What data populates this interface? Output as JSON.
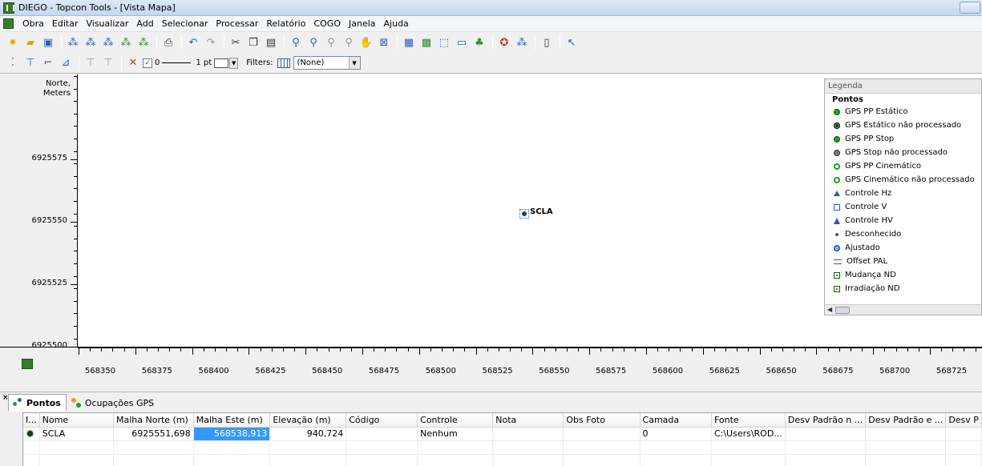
{
  "window": {
    "title": "DIEGO - Topcon Tools - [Vista Mapa]"
  },
  "menu": [
    "Obra",
    "Editar",
    "Visualizar",
    "Add",
    "Selecionar",
    "Processar",
    "Relatório",
    "COGO",
    "Janela",
    "Ajuda"
  ],
  "toolbar2": {
    "line_width_value": "0",
    "pt_label": "1 pt",
    "filters_label": "Filters:",
    "filter_value": "(None)"
  },
  "map": {
    "y_axis_title_line1": "Norte,",
    "y_axis_title_line2": "Meters",
    "y_ticks": [
      "6925575",
      "6925550",
      "6925525",
      "6925500"
    ],
    "x_ticks": [
      "568350",
      "568375",
      "568400",
      "568425",
      "568450",
      "568475",
      "568500",
      "568525",
      "568550",
      "568575",
      "568600",
      "568625",
      "568650",
      "568675",
      "568700",
      "568725"
    ],
    "point_label": "SCLA"
  },
  "legend": {
    "header": "Legenda",
    "group": "Pontos",
    "items": [
      {
        "label": "GPS PP Estático",
        "symbol": "dot-green"
      },
      {
        "label": "GPS Estático não processado",
        "symbol": "dot-black"
      },
      {
        "label": "GPS PP Stop",
        "symbol": "dot-green"
      },
      {
        "label": "GPS Stop não processado",
        "symbol": "dot-gray"
      },
      {
        "label": "GPS PP Cinemático",
        "symbol": "ring-green"
      },
      {
        "label": "GPS Cinemático não processado",
        "symbol": "ring-green"
      },
      {
        "label": "Controle Hz",
        "symbol": "tri-blue"
      },
      {
        "label": "Controle V",
        "symbol": "sq-blue"
      },
      {
        "label": "Controle HV",
        "symbol": "tri-blue2"
      },
      {
        "label": "Desconhecido",
        "symbol": "dot-small"
      },
      {
        "label": "Ajustado",
        "symbol": "target-blue"
      },
      {
        "label": "Offset PAL",
        "symbol": "arrows"
      },
      {
        "label": "Mudança ND",
        "symbol": "sq-green"
      },
      {
        "label": "Irradiação ND",
        "symbol": "sq-green"
      }
    ]
  },
  "bottom": {
    "tabs": [
      "Pontos",
      "Ocupações GPS"
    ],
    "columns": [
      "I...",
      "Nome",
      "Malha Norte (m)",
      "Malha Este (m)",
      "Elevação (m)",
      "Código",
      "Controle",
      "Nota",
      "Obs Foto",
      "Camada",
      "Fonte",
      "Desv Padrão n ...",
      "Desv Padrão e ...",
      "Desv P"
    ],
    "rows": [
      {
        "nome": "SCLA",
        "norte": "6925551,698",
        "este": "568538,913",
        "elevacao": "940,724",
        "codigo": "",
        "controle": "Nenhum",
        "nota": "",
        "obs_foto": "",
        "camada": "0",
        "fonte": "C:\\Users\\ROD...",
        "desv_n": "",
        "desv_e": "",
        "desv_p": ""
      }
    ]
  }
}
